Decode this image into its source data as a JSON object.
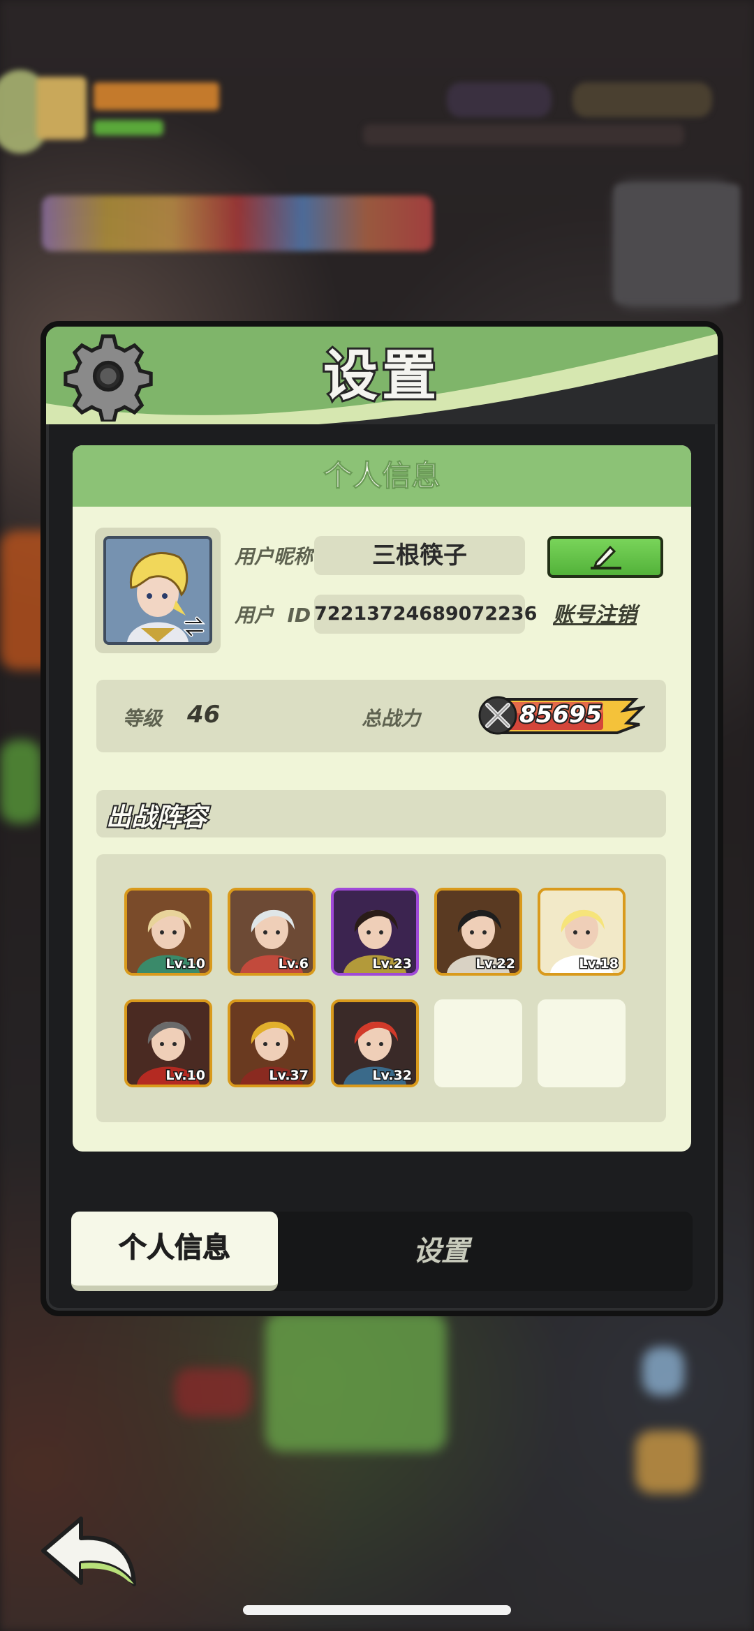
{
  "window": {
    "title": "设置"
  },
  "info_card": {
    "header": "个人信息",
    "nickname_label": "用户昵称",
    "nickname_value": "三根筷子",
    "id_label": "用户  ID",
    "id_value": "72213724689072236",
    "deactivate_link": "账号注销",
    "level_label": "等级",
    "level_value": "46",
    "power_label": "总战力",
    "power_value": "85695",
    "lineup_title": "出战阵容"
  },
  "lineup": [
    {
      "level": "Lv.10",
      "rarity": "orange",
      "bg": "#7a4b2a",
      "hair": "#e8d39a",
      "cloth": "#3a8a6a"
    },
    {
      "level": "Lv.6",
      "rarity": "orange",
      "bg": "#6d4a35",
      "hair": "#dfe6e8",
      "cloth": "#c24a3c"
    },
    {
      "level": "Lv.23",
      "rarity": "purple",
      "bg": "#3c2450",
      "hair": "#2a1c18",
      "cloth": "#b39a3a"
    },
    {
      "level": "Lv.22",
      "rarity": "orange",
      "bg": "#5a3a22",
      "hair": "#1e1e1e",
      "cloth": "#d9d2c4"
    },
    {
      "level": "Lv.18",
      "rarity": "orange",
      "bg": "#f2e9c8",
      "hair": "#f6e47a",
      "cloth": "#ffffff"
    },
    {
      "level": "Lv.10",
      "rarity": "orange",
      "bg": "#4a2a22",
      "hair": "#6a6a6a",
      "cloth": "#b42a22"
    },
    {
      "level": "Lv.37",
      "rarity": "orange",
      "bg": "#6a3a20",
      "hair": "#e2b02c",
      "cloth": "#8a2a20"
    },
    {
      "level": "Lv.32",
      "rarity": "orange",
      "bg": "#3a2a28",
      "hair": "#d23a2a",
      "cloth": "#3a6a8a"
    }
  ],
  "empty_slots": 2,
  "tabs": {
    "active_label": "个人信息",
    "inactive_label": "设置"
  },
  "colors": {
    "panel_green": "#7fb56a",
    "card_bg": "#f0f5d8",
    "field_bg": "#dbdec3",
    "edit_button": "#5cbf40",
    "orange_frame": "#d99a1c",
    "purple_frame": "#a04ad8"
  },
  "icons": {
    "settings": "gear-icon",
    "edit": "pencil-icon",
    "power": "crossed-swords-icon",
    "switch": "swap-arrow-icon",
    "back": "back-arrow-icon"
  }
}
